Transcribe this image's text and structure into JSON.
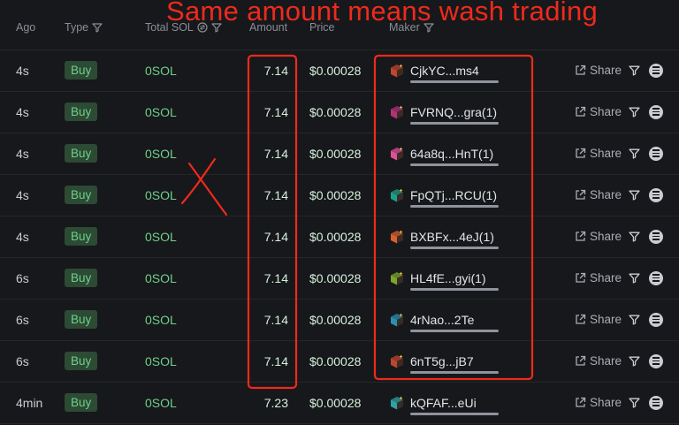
{
  "header": {
    "ago": "Ago",
    "type": "Type",
    "total": "Total SOL",
    "amount": "Amount",
    "price": "Price",
    "maker": "Maker"
  },
  "annotation": "Same amount means wash trading",
  "colors": {
    "buy_bg": "#2c4a34",
    "buy_text": "#6fd08a",
    "annotation": "#ee2a1c"
  },
  "rows": [
    {
      "ago": "4s",
      "type": "Buy",
      "total": "0SOL",
      "amount": "7.14",
      "price": "$0.00028",
      "maker": "CjkYC...ms4",
      "cube": "#c0452f",
      "share": "Share"
    },
    {
      "ago": "4s",
      "type": "Buy",
      "total": "0SOL",
      "amount": "7.14",
      "price": "$0.00028",
      "maker": "FVRNQ...gra(1)",
      "cube": "#b4327a",
      "share": "Share"
    },
    {
      "ago": "4s",
      "type": "Buy",
      "total": "0SOL",
      "amount": "7.14",
      "price": "$0.00028",
      "maker": "64a8q...HnT(1)",
      "cube": "#e0509a",
      "share": "Share"
    },
    {
      "ago": "4s",
      "type": "Buy",
      "total": "0SOL",
      "amount": "7.14",
      "price": "$0.00028",
      "maker": "FpQTj...RCU(1)",
      "cube": "#1f9e8a",
      "share": "Share"
    },
    {
      "ago": "4s",
      "type": "Buy",
      "total": "0SOL",
      "amount": "7.14",
      "price": "$0.00028",
      "maker": "BXBFx...4eJ(1)",
      "cube": "#d8602e",
      "share": "Share"
    },
    {
      "ago": "6s",
      "type": "Buy",
      "total": "0SOL",
      "amount": "7.14",
      "price": "$0.00028",
      "maker": "HL4fE...gyi(1)",
      "cube": "#7da62a",
      "share": "Share"
    },
    {
      "ago": "6s",
      "type": "Buy",
      "total": "0SOL",
      "amount": "7.14",
      "price": "$0.00028",
      "maker": "4rNao...2Te",
      "cube": "#2b8fb0",
      "share": "Share"
    },
    {
      "ago": "6s",
      "type": "Buy",
      "total": "0SOL",
      "amount": "7.14",
      "price": "$0.00028",
      "maker": "6nT5g...jB7",
      "cube": "#c0452f",
      "share": "Share"
    },
    {
      "ago": "4min",
      "type": "Buy",
      "total": "0SOL",
      "amount": "7.23",
      "price": "$0.00028",
      "maker": "kQFAF...eUi",
      "cube": "#2fa3a3",
      "share": "Share"
    }
  ]
}
